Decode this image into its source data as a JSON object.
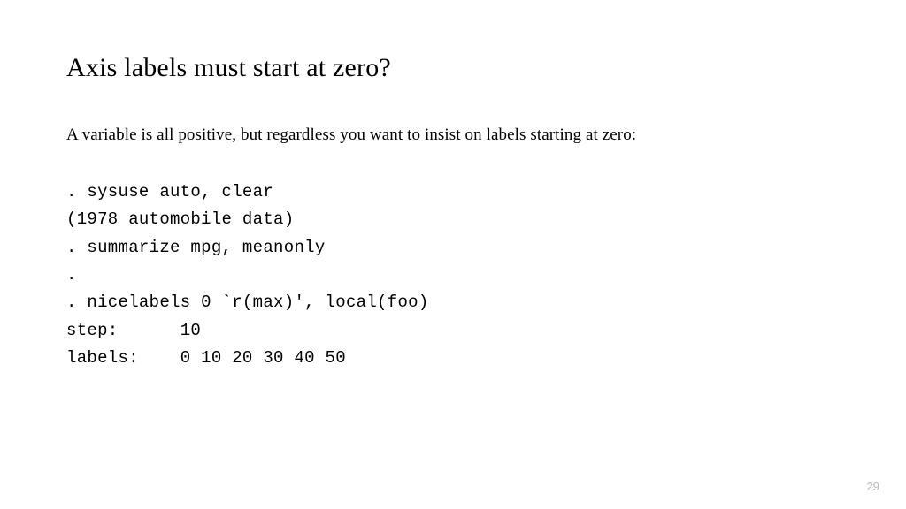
{
  "title": "Axis labels must start at zero?",
  "body": "A variable is all positive, but regardless you want to insist on labels starting at zero:",
  "code": {
    "line1": ". sysuse auto, clear",
    "line2": "(1978 automobile data)",
    "line3": "",
    "line4": ". summarize mpg, meanonly",
    "line5": ".",
    "line6": ". nicelabels 0 `r(max)', local(foo)",
    "line7": "step:      10",
    "line8": "labels:    0 10 20 30 40 50"
  },
  "pageNumber": "29"
}
